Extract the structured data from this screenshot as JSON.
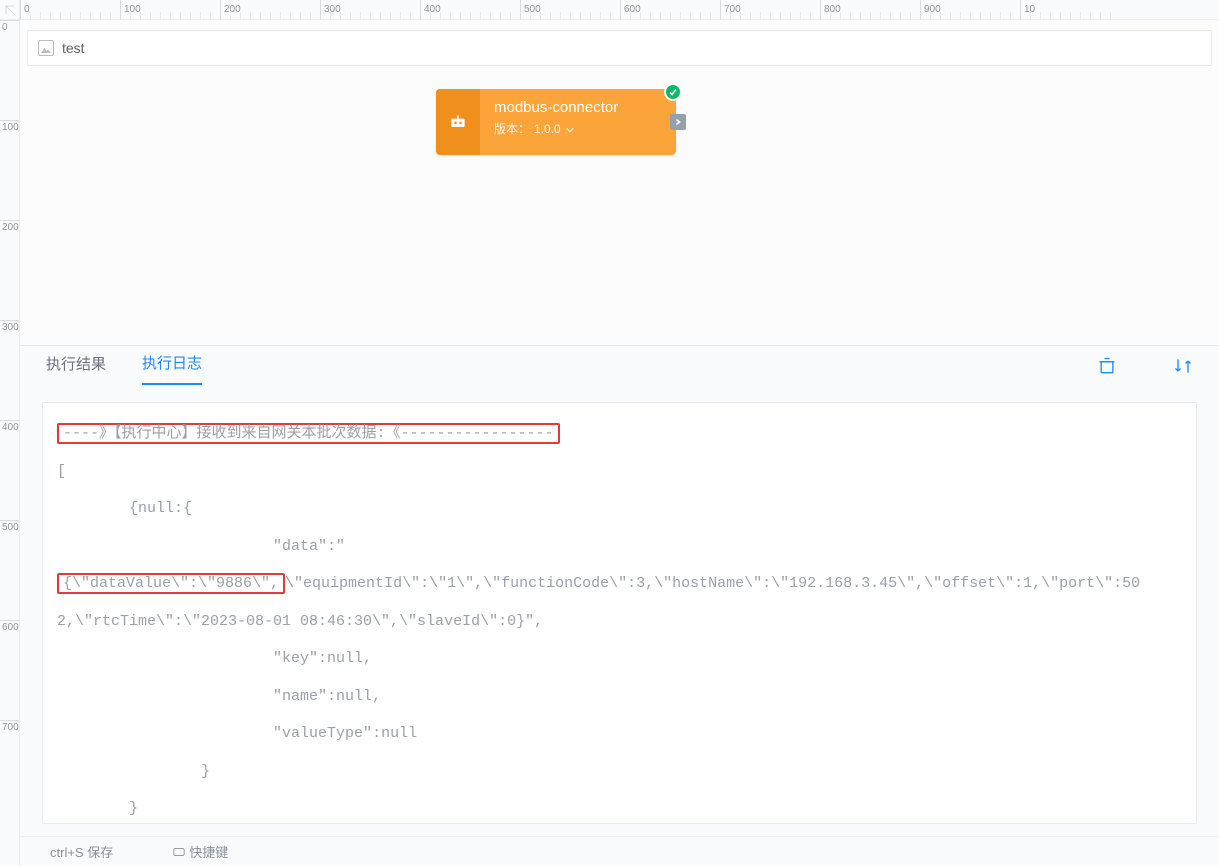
{
  "ruler_h": [
    "0",
    "100",
    "200",
    "300",
    "400",
    "500",
    "600",
    "700",
    "800",
    "900",
    "10"
  ],
  "ruler_v": [
    "0",
    "100",
    "200",
    "300",
    "400",
    "500",
    "600",
    "700"
  ],
  "titlebar": {
    "title": "test"
  },
  "node": {
    "title": "modbus-connector",
    "version_label": "版本：",
    "version_value": "1.0.0"
  },
  "panel": {
    "tabs": {
      "results": "执行结果",
      "logs": "执行日志"
    }
  },
  "log": {
    "line_header": "----》【执行中心】接收到来自网关本批次数据:《-----------------",
    "line_open": "[",
    "line_null_open": "        {null:{",
    "line_data": "                        \"data\":\"",
    "line_datavalue": "{\\\"dataValue\\\":\\\"9886\\\",",
    "line_rest1": "\\\"equipmentId\\\":\\\"1\\\",\\\"functionCode\\\":3,\\\"hostName\\\":\\\"192.168.3.45\\\",\\\"offset\\\":1,\\\"port\\\":502,\\\"rtcTime\\\":\\\"2023-08-01 08:46:30\\\",\\\"slaveId\\\":0}\",",
    "line_key": "                        \"key\":null,",
    "line_name": "                        \"name\":null,",
    "line_vt": "                        \"valueType\":null",
    "line_close1": "                }",
    "line_close2": "        }"
  },
  "statusbar": {
    "save": "ctrl+S 保存",
    "shortcut": "快捷键"
  }
}
